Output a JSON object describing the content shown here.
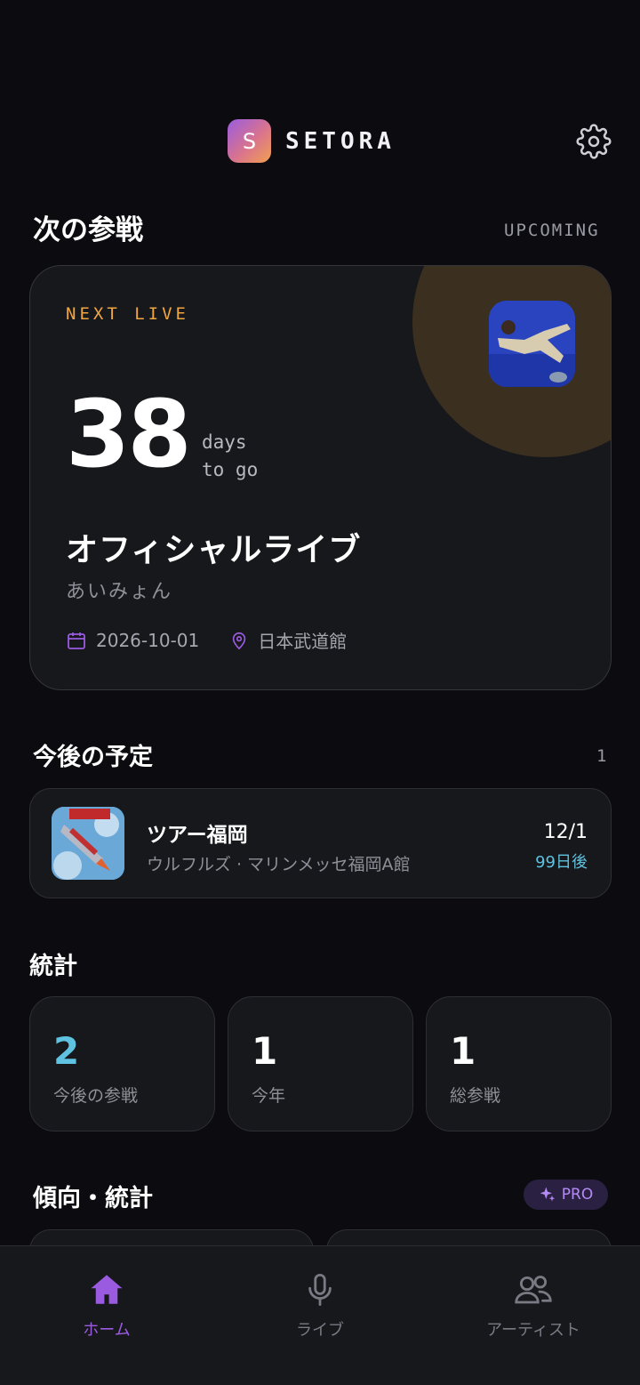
{
  "header": {
    "logo_letter": "S",
    "app_name": "SETORA",
    "settings_icon": "gear-icon"
  },
  "next_section": {
    "title": "次の参戦",
    "tag": "UPCOMING"
  },
  "next_card": {
    "label": "NEXT LIVE",
    "days": "38",
    "days_line1": "days",
    "days_line2": "to go",
    "event_title": "オフィシャルライブ",
    "artist": "あいみょん",
    "date": "2026-10-01",
    "venue": "日本武道館",
    "accent": "#f0a640",
    "icon_color": "#9a5be0"
  },
  "upcoming_section": {
    "title": "今後の予定",
    "count": "1"
  },
  "upcoming_items": [
    {
      "title": "ツアー福岡",
      "subtitle": "ウルフルズ · マリンメッセ福岡A館",
      "date": "12/1",
      "relative": "99日後"
    }
  ],
  "stats_section": {
    "title": "統計"
  },
  "stats": [
    {
      "value": "2",
      "label": "今後の参戦",
      "color": "#5fc2e0"
    },
    {
      "value": "1",
      "label": "今年",
      "color": "#ffffff"
    },
    {
      "value": "1",
      "label": "総参戦",
      "color": "#ffffff"
    }
  ],
  "trend_section": {
    "title": "傾向・統計",
    "badge": "PRO"
  },
  "bottom_nav": {
    "items": [
      {
        "label": "ホーム",
        "icon": "home-icon",
        "active": true
      },
      {
        "label": "ライブ",
        "icon": "microphone-icon",
        "active": false
      },
      {
        "label": "アーティスト",
        "icon": "users-icon",
        "active": false
      }
    ],
    "active_color": "#9a5be0",
    "inactive_color": "#7a7a84"
  }
}
